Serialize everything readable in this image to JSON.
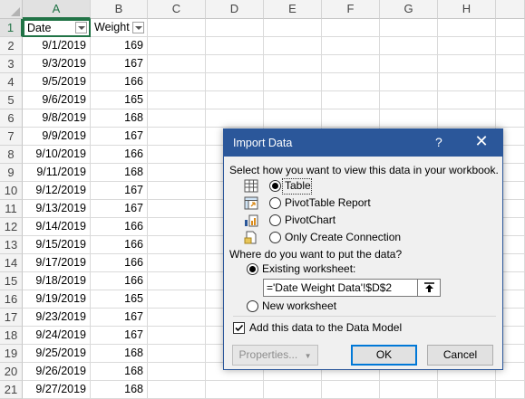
{
  "columns": [
    "A",
    "B",
    "C",
    "D",
    "E",
    "F",
    "G",
    "H"
  ],
  "header_row": {
    "row_number": "1",
    "col_a": "Date",
    "col_b": "Weight"
  },
  "rows": [
    {
      "n": "2",
      "date": "9/1/2019",
      "weight": "169"
    },
    {
      "n": "3",
      "date": "9/3/2019",
      "weight": "167"
    },
    {
      "n": "4",
      "date": "9/5/2019",
      "weight": "166"
    },
    {
      "n": "5",
      "date": "9/6/2019",
      "weight": "165"
    },
    {
      "n": "6",
      "date": "9/8/2019",
      "weight": "168"
    },
    {
      "n": "7",
      "date": "9/9/2019",
      "weight": "167"
    },
    {
      "n": "8",
      "date": "9/10/2019",
      "weight": "166"
    },
    {
      "n": "9",
      "date": "9/11/2019",
      "weight": "168"
    },
    {
      "n": "10",
      "date": "9/12/2019",
      "weight": "167"
    },
    {
      "n": "11",
      "date": "9/13/2019",
      "weight": "167"
    },
    {
      "n": "12",
      "date": "9/14/2019",
      "weight": "166"
    },
    {
      "n": "13",
      "date": "9/15/2019",
      "weight": "166"
    },
    {
      "n": "14",
      "date": "9/17/2019",
      "weight": "166"
    },
    {
      "n": "15",
      "date": "9/18/2019",
      "weight": "166"
    },
    {
      "n": "16",
      "date": "9/19/2019",
      "weight": "165"
    },
    {
      "n": "17",
      "date": "9/23/2019",
      "weight": "167"
    },
    {
      "n": "18",
      "date": "9/24/2019",
      "weight": "167"
    },
    {
      "n": "19",
      "date": "9/25/2019",
      "weight": "168"
    },
    {
      "n": "20",
      "date": "9/26/2019",
      "weight": "168"
    },
    {
      "n": "21",
      "date": "9/27/2019",
      "weight": "168"
    }
  ],
  "dialog": {
    "title": "Import Data",
    "help": "?",
    "close": "✕",
    "view_prompt": "Select how you want to view this data in your workbook.",
    "view_options": [
      {
        "label": "Table",
        "selected": true,
        "icon": "table-icon"
      },
      {
        "label": "PivotTable Report",
        "selected": false,
        "icon": "pivottable-icon"
      },
      {
        "label": "PivotChart",
        "selected": false,
        "icon": "pivotchart-icon"
      },
      {
        "label": "Only Create Connection",
        "selected": false,
        "icon": "connection-icon"
      }
    ],
    "location_prompt": "Where do you want to put the data?",
    "existing_label": "Existing worksheet:",
    "existing_selected": true,
    "reference_value": "='Date Weight Data'!$D$2",
    "new_label": "New worksheet",
    "data_model_label": "Add this data to the Data Model",
    "data_model_checked": true,
    "properties_label": "Properties...",
    "ok_label": "OK",
    "cancel_label": "Cancel"
  },
  "colors": {
    "accent": "#2b579a",
    "excel_green": "#217346"
  }
}
